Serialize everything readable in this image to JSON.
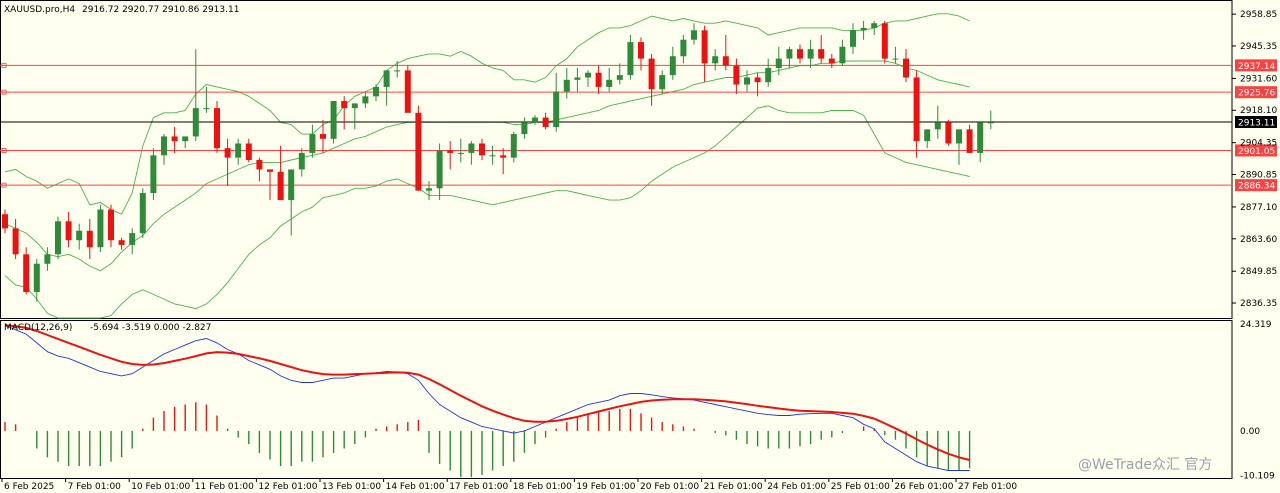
{
  "header": {
    "symbol": "XAUUSD.pro,H4",
    "ohlc": "2916.72 2920.77 2910.86 2913.11"
  },
  "watermark": "@WeTrade众汇 官方",
  "colors": {
    "background": "#fffff0",
    "bull": "#2e8b3a",
    "bear": "#ee1111",
    "bands": "#49b449",
    "level_line": "#ff4040",
    "macd_line": "#2233dd",
    "signal_line": "#ee1111"
  },
  "chart_data": [
    {
      "type": "candlestick",
      "instrument": "XAUUSD.pro",
      "timeframe": "H4",
      "ylim": [
        2830,
        2964
      ],
      "y_ticks": [
        "2958.85",
        "2945.35",
        "2931.60",
        "2918.10",
        "2904.35",
        "2890.85",
        "2877.10",
        "2863.60",
        "2849.85",
        "2836.35"
      ],
      "y_tick_values": [
        2958.85,
        2945.35,
        2931.6,
        2918.1,
        2904.35,
        2890.85,
        2877.1,
        2863.6,
        2849.85,
        2836.35
      ],
      "x_labels": [
        "6 Feb 2025",
        "7 Feb 01:00",
        "10 Feb 01:00",
        "11 Feb 01:00",
        "12 Feb 01:00",
        "13 Feb 01:00",
        "14 Feb 01:00",
        "17 Feb 01:00",
        "18 Feb 01:00",
        "19 Feb 01:00",
        "20 Feb 01:00",
        "21 Feb 01:00",
        "24 Feb 01:00",
        "25 Feb 01:00",
        "26 Feb 01:00",
        "27 Feb 01:00"
      ],
      "x_label_index": [
        0,
        6,
        12,
        18,
        24,
        30,
        36,
        42,
        48,
        54,
        60,
        66,
        72,
        78,
        84,
        90
      ],
      "levels": [
        {
          "label": "2937.14",
          "value": 2937.14
        },
        {
          "label": "2925.76",
          "value": 2925.76
        },
        {
          "label": "2901.05",
          "value": 2901.05
        },
        {
          "label": "2886.34",
          "value": 2886.34
        }
      ],
      "current_price": {
        "label": "2913.11",
        "value": 2913.11
      },
      "candles": [
        [
          2874,
          2876,
          2866,
          2868
        ],
        [
          2868,
          2872,
          2855,
          2857
        ],
        [
          2857,
          2860,
          2840,
          2841
        ],
        [
          2841,
          2855,
          2837,
          2853
        ],
        [
          2853,
          2860,
          2850,
          2857
        ],
        [
          2857,
          2873,
          2855,
          2871
        ],
        [
          2871,
          2875,
          2860,
          2863
        ],
        [
          2863,
          2870,
          2859,
          2867
        ],
        [
          2867,
          2872,
          2855,
          2860
        ],
        [
          2860,
          2878,
          2858,
          2876
        ],
        [
          2876,
          2878,
          2860,
          2863
        ],
        [
          2863,
          2864,
          2859,
          2861
        ],
        [
          2861,
          2868,
          2857,
          2866
        ],
        [
          2866,
          2885,
          2864,
          2883
        ],
        [
          2883,
          2902,
          2880,
          2899
        ],
        [
          2899,
          2908,
          2895,
          2907
        ],
        [
          2907,
          2911,
          2900,
          2905
        ],
        [
          2905,
          2907,
          2902,
          2907
        ],
        [
          2907,
          2944,
          2905,
          2919
        ],
        [
          2919,
          2928,
          2917,
          2919
        ],
        [
          2919,
          2922,
          2900,
          2902
        ],
        [
          2902,
          2906,
          2886,
          2898
        ],
        [
          2898,
          2906,
          2895,
          2904
        ],
        [
          2904,
          2906,
          2896,
          2897
        ],
        [
          2897,
          2898,
          2888,
          2893
        ],
        [
          2893,
          2893,
          2880,
          2892
        ],
        [
          2892,
          2903,
          2880,
          2880
        ],
        [
          2880,
          2893,
          2865,
          2893
        ],
        [
          2893,
          2902,
          2890,
          2900
        ],
        [
          2900,
          2912,
          2898,
          2908
        ],
        [
          2908,
          2914,
          2900,
          2906
        ],
        [
          2906,
          2922,
          2904,
          2922
        ],
        [
          2922,
          2924,
          2910,
          2919
        ],
        [
          2919,
          2921,
          2910,
          2921
        ],
        [
          2921,
          2926,
          2919,
          2924
        ],
        [
          2924,
          2929,
          2922,
          2928
        ],
        [
          2928,
          2932,
          2920,
          2935
        ],
        [
          2935,
          2939,
          2932,
          2935
        ],
        [
          2935,
          2937,
          2920,
          2917
        ],
        [
          2917,
          2920,
          2884,
          2884
        ],
        [
          2884,
          2888,
          2880,
          2885
        ],
        [
          2885,
          2904,
          2880,
          2901
        ],
        [
          2901,
          2905,
          2893,
          2900
        ],
        [
          2900,
          2906,
          2896,
          2900
        ],
        [
          2900,
          2905,
          2895,
          2904
        ],
        [
          2904,
          2906,
          2897,
          2899
        ],
        [
          2899,
          2903,
          2895,
          2899
        ],
        [
          2899,
          2902,
          2891,
          2898
        ],
        [
          2898,
          2909,
          2896,
          2908
        ],
        [
          2908,
          2915,
          2906,
          2913
        ],
        [
          2913,
          2916,
          2912,
          2915
        ],
        [
          2915,
          2917,
          2910,
          2911
        ],
        [
          2911,
          2934,
          2909,
          2926
        ],
        [
          2926,
          2936,
          2923,
          2931
        ],
        [
          2931,
          2936,
          2926,
          2932
        ],
        [
          2932,
          2935,
          2928,
          2934
        ],
        [
          2934,
          2937,
          2925,
          2928
        ],
        [
          2928,
          2936,
          2926,
          2931
        ],
        [
          2931,
          2938,
          2929,
          2933
        ],
        [
          2933,
          2950,
          2931,
          2947
        ],
        [
          2947,
          2949,
          2935,
          2940
        ],
        [
          2940,
          2942,
          2920,
          2927
        ],
        [
          2927,
          2935,
          2925,
          2933
        ],
        [
          2933,
          2945,
          2931,
          2941
        ],
        [
          2941,
          2950,
          2938,
          2948
        ],
        [
          2948,
          2955,
          2946,
          2952
        ],
        [
          2952,
          2954,
          2930,
          2938
        ],
        [
          2938,
          2944,
          2935,
          2941
        ],
        [
          2941,
          2950,
          2935,
          2937
        ],
        [
          2937,
          2940,
          2925,
          2929
        ],
        [
          2929,
          2935,
          2926,
          2932
        ],
        [
          2932,
          2934,
          2924,
          2930
        ],
        [
          2930,
          2940,
          2928,
          2936
        ],
        [
          2936,
          2945,
          2933,
          2940
        ],
        [
          2940,
          2945,
          2936,
          2944
        ],
        [
          2944,
          2946,
          2938,
          2940
        ],
        [
          2940,
          2948,
          2936,
          2944
        ],
        [
          2944,
          2950,
          2938,
          2940
        ],
        [
          2940,
          2942,
          2936,
          2938
        ],
        [
          2938,
          2948,
          2937,
          2945
        ],
        [
          2945,
          2955,
          2942,
          2952
        ],
        [
          2952,
          2956,
          2948,
          2953
        ],
        [
          2953,
          2956,
          2950,
          2955
        ],
        [
          2955,
          2956,
          2938,
          2940
        ],
        [
          2940,
          2945,
          2938,
          2940
        ],
        [
          2940,
          2944,
          2930,
          2932
        ],
        [
          2932,
          2935,
          2898,
          2905
        ],
        [
          2905,
          2910,
          2902,
          2910
        ],
        [
          2910,
          2920,
          2906,
          2913
        ],
        [
          2913,
          2914,
          2903,
          2904
        ],
        [
          2904,
          2910,
          2895,
          2910
        ],
        [
          2910,
          2912,
          2900,
          2900
        ],
        [
          2900,
          2913,
          2896,
          2913
        ],
        [
          2913,
          2918,
          2910,
          2913
        ]
      ],
      "bollinger": {
        "period_note": "",
        "upper": [
          2892,
          2893,
          2890,
          2888,
          2885,
          2887,
          2889,
          2887,
          2878,
          2879,
          2876,
          2874,
          2883,
          2903,
          2915,
          2917,
          2917,
          2918,
          2925,
          2929,
          2928,
          2927,
          2926,
          2924,
          2921,
          2918,
          2913,
          2912,
          2908,
          2908,
          2912,
          2914,
          2920,
          2924,
          2926,
          2928,
          2935,
          2938,
          2940,
          2941,
          2942,
          2942,
          2941,
          2943,
          2941,
          2938,
          2936,
          2935,
          2931,
          2931,
          2930,
          2932,
          2937,
          2940,
          2945,
          2948,
          2951,
          2953,
          2953,
          2954,
          2956,
          2958,
          2957,
          2956,
          2957,
          2956,
          2955,
          2955,
          2956,
          2955,
          2954,
          2953,
          2950,
          2951,
          2952,
          2953,
          2953,
          2953,
          2953,
          2952,
          2952,
          2952,
          2953,
          2955,
          2956,
          2956,
          2957,
          2958,
          2959,
          2959,
          2958,
          2956
        ],
        "middle": [
          2870,
          2868,
          2866,
          2862,
          2857,
          2856,
          2857,
          2855,
          2852,
          2850,
          2853,
          2858,
          2862,
          2865,
          2870,
          2874,
          2877,
          2880,
          2883,
          2887,
          2889,
          2891,
          2893,
          2895,
          2896,
          2896,
          2896,
          2897,
          2898,
          2899,
          2900,
          2902,
          2904,
          2906,
          2907,
          2909,
          2911,
          2912,
          2913,
          2913,
          2913,
          2913,
          2913,
          2913,
          2913,
          2913,
          2913,
          2913,
          2912,
          2912,
          2913,
          2913,
          2914,
          2915,
          2916,
          2917,
          2918,
          2920,
          2921,
          2922,
          2923,
          2924,
          2925,
          2926,
          2927,
          2929,
          2930,
          2931,
          2932,
          2932,
          2933,
          2934,
          2934,
          2935,
          2936,
          2937,
          2937,
          2938,
          2938,
          2939,
          2939,
          2939,
          2939,
          2939,
          2938,
          2936,
          2935,
          2933,
          2931,
          2930,
          2929,
          2928
        ],
        "lower": [
          2848,
          2844,
          2843,
          2838,
          2832,
          2830,
          2830,
          2830,
          2830,
          2830,
          2831,
          2836,
          2840,
          2842,
          2840,
          2838,
          2836,
          2835,
          2834,
          2836,
          2840,
          2845,
          2851,
          2857,
          2861,
          2864,
          2869,
          2872,
          2875,
          2877,
          2881,
          2882,
          2883,
          2885,
          2885,
          2886,
          2888,
          2889,
          2887,
          2885,
          2882,
          2882,
          2882,
          2881,
          2880,
          2879,
          2878,
          2879,
          2880,
          2881,
          2882,
          2883,
          2884,
          2884,
          2883,
          2882,
          2881,
          2880,
          2880,
          2881,
          2884,
          2888,
          2891,
          2894,
          2896,
          2898,
          2900,
          2903,
          2907,
          2911,
          2915,
          2919,
          2920,
          2918,
          2917,
          2917,
          2917,
          2917,
          2918,
          2918,
          2918,
          2916,
          2908,
          2900,
          2898,
          2896,
          2895,
          2894,
          2893,
          2892,
          2891,
          2890
        ]
      }
    },
    {
      "type": "macd",
      "title": "MACD(12,26,9)",
      "values_text": "-5.694 -3.519 0.000 -2.827",
      "y_ticks": [
        "24.319",
        "0.00",
        "-10.109"
      ],
      "y_tick_values": [
        24.319,
        0,
        -10.109
      ],
      "ylim": [
        -10.7,
        25.2
      ],
      "macd": [
        24,
        23,
        22,
        20,
        18,
        17,
        16.5,
        15.5,
        14.5,
        13.5,
        13,
        12.5,
        13,
        14.5,
        16,
        17.5,
        18.5,
        19.5,
        20.5,
        21,
        20,
        18.5,
        17.5,
        16,
        15,
        14,
        12.5,
        11.5,
        11,
        11,
        11.5,
        12,
        12,
        12.5,
        13,
        13.2,
        13.5,
        13.4,
        13,
        11.5,
        8.5,
        6,
        4.5,
        3,
        2,
        1,
        0.5,
        0,
        -0.5,
        0,
        1,
        2,
        3,
        4,
        5,
        6,
        6.5,
        7,
        8,
        8.5,
        8.5,
        8.2,
        7.8,
        7.5,
        7.3,
        7,
        6.5,
        6,
        5.5,
        5,
        4.5,
        4,
        3.7,
        3.5,
        3.5,
        3.8,
        3.9,
        4,
        4,
        3.5,
        3,
        1.5,
        0.5,
        -2.5,
        -4,
        -5.5,
        -7,
        -8,
        -8.5,
        -9,
        -9,
        -9
      ],
      "signal": [
        24,
        23.8,
        23.4,
        22.7,
        21.8,
        20.9,
        20,
        19.1,
        18.2,
        17.3,
        16.5,
        15.7,
        15.2,
        15,
        15.1,
        15.4,
        15.9,
        16.4,
        17,
        17.6,
        17.9,
        17.8,
        17.5,
        17,
        16.5,
        15.9,
        15.2,
        14.5,
        13.8,
        13.3,
        12.9,
        12.8,
        12.8,
        12.9,
        13,
        13.1,
        13.2,
        13.3,
        13.2,
        12.8,
        11.8,
        10.6,
        9.3,
        8,
        6.8,
        5.6,
        4.6,
        3.7,
        2.9,
        2.3,
        2.1,
        2.1,
        2.3,
        2.7,
        3.2,
        3.8,
        4.4,
        5,
        5.6,
        6.1,
        6.6,
        6.9,
        7.1,
        7.2,
        7.2,
        7.2,
        7.1,
        6.9,
        6.7,
        6.4,
        6.1,
        5.7,
        5.4,
        5.1,
        4.8,
        4.6,
        4.5,
        4.4,
        4.3,
        4.1,
        3.9,
        3.4,
        2.8,
        1.7,
        0.6,
        -0.6,
        -1.9,
        -3.1,
        -4.2,
        -5.2,
        -6,
        -6.6
      ],
      "histogram": [
        2,
        1.5,
        0,
        -4,
        -6,
        -7,
        -8,
        -8,
        -8,
        -8,
        -7,
        -6,
        -4,
        0.5,
        3,
        4.5,
        5.5,
        6,
        6.5,
        6,
        3.5,
        0.5,
        -1.5,
        -3,
        -5,
        -6.5,
        -8,
        -8,
        -7,
        -7,
        -6,
        -5,
        -4,
        -3,
        -1.5,
        0.5,
        1,
        1.5,
        2,
        2.5,
        -5,
        -7.5,
        -9,
        -10.5,
        -10.5,
        -10,
        -9,
        -8,
        -7,
        -5,
        -3,
        -1.5,
        0.5,
        2,
        3,
        4,
        4.5,
        4.5,
        5,
        5,
        4,
        3,
        2,
        1.5,
        1,
        0.5,
        0,
        -0.5,
        -1,
        -2,
        -3,
        -3.5,
        -4,
        -4,
        -4,
        -3.5,
        -3,
        -2,
        -1.5,
        -0.5,
        0,
        1,
        0.5,
        -1,
        -2,
        -4,
        -6,
        -8,
        -8.5,
        -9,
        -9,
        -8.5
      ]
    }
  ]
}
